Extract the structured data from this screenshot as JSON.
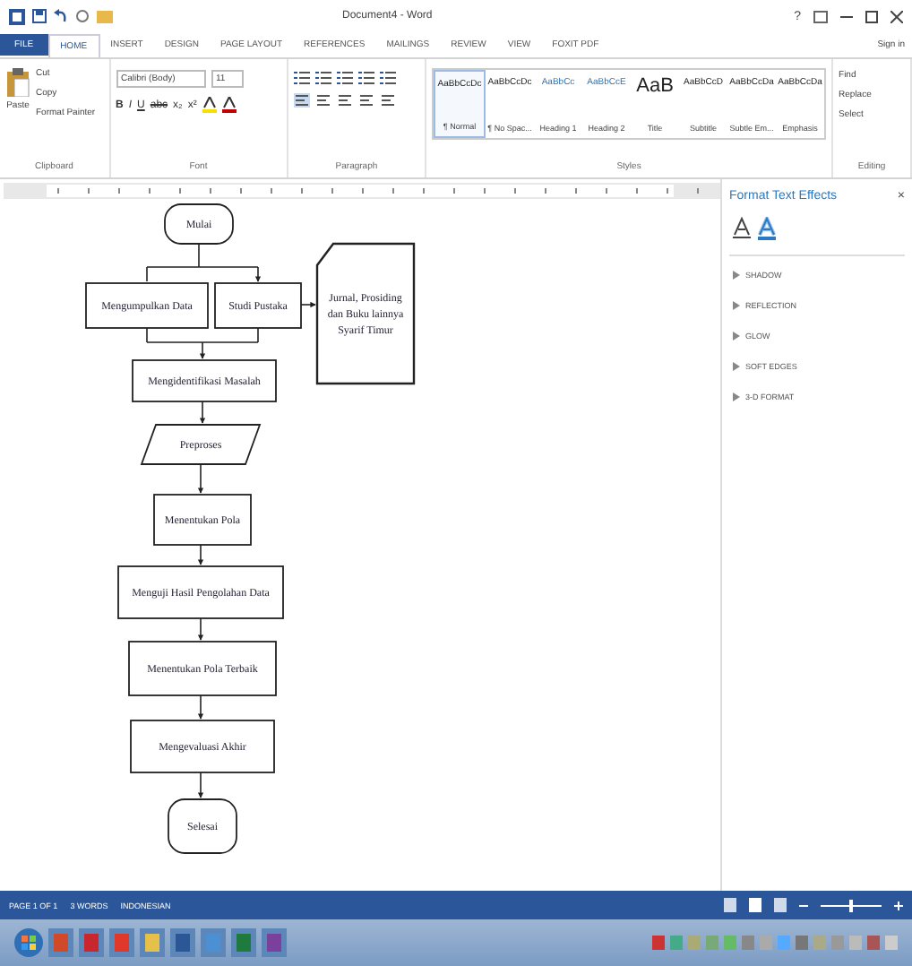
{
  "window": {
    "title": "Document4 - Word",
    "help": "?"
  },
  "tabs": [
    {
      "label": "FILE",
      "kind": "file",
      "selected": false
    },
    {
      "label": "HOME",
      "kind": "tab",
      "selected": true
    },
    {
      "label": "INSERT",
      "kind": "tab",
      "selected": false
    },
    {
      "label": "DESIGN",
      "kind": "tab",
      "selected": false
    },
    {
      "label": "PAGE LAYOUT",
      "kind": "tab",
      "selected": false
    },
    {
      "label": "REFERENCES",
      "kind": "tab",
      "selected": false
    },
    {
      "label": "MAILINGS",
      "kind": "tab",
      "selected": false
    },
    {
      "label": "REVIEW",
      "kind": "tab",
      "selected": false
    },
    {
      "label": "VIEW",
      "kind": "tab",
      "selected": false
    },
    {
      "label": "FOXIT PDF",
      "kind": "tab",
      "selected": false
    }
  ],
  "sign_in": "Sign in",
  "ribbon": {
    "clipboard": {
      "paste": "Paste",
      "items": [
        "Cut",
        "Copy",
        "Format Painter"
      ],
      "label": "Clipboard"
    },
    "font": {
      "family": "Calibri (Body)",
      "size": "11",
      "buttons": [
        "B",
        "I",
        "U",
        "abc",
        "x₂",
        "x²"
      ],
      "label": "Font"
    },
    "paragraph": {
      "label": "Paragraph"
    },
    "styles": {
      "items": [
        {
          "preview": "AaBbCcDc",
          "name": "¶ Normal",
          "kind": "body",
          "selected": true
        },
        {
          "preview": "AaBbCcDc",
          "name": "¶ No Spac...",
          "kind": "body",
          "selected": false
        },
        {
          "preview": "AaBbCc",
          "name": "Heading 1",
          "kind": "heading",
          "selected": false
        },
        {
          "preview": "AaBbCcE",
          "name": "Heading 2",
          "kind": "heading",
          "selected": false
        },
        {
          "preview": "AaB",
          "name": "Title",
          "kind": "title",
          "selected": false
        },
        {
          "preview": "AaBbCcD",
          "name": "Subtitle",
          "kind": "body",
          "selected": false
        },
        {
          "preview": "AaBbCcDa",
          "name": "Subtle Em...",
          "kind": "body",
          "selected": false
        },
        {
          "preview": "AaBbCcDa",
          "name": "Emphasis",
          "kind": "body",
          "selected": false
        }
      ],
      "label": "Styles"
    },
    "editing": {
      "items": [
        "Find",
        "Replace",
        "Select"
      ],
      "label": "Editing"
    }
  },
  "flowchart": {
    "nodes": [
      {
        "kind": "terminator",
        "label": "Mulai"
      },
      {
        "kind": "process",
        "label": "Mengumpulkan Data"
      },
      {
        "kind": "process",
        "label": "Studi Pustaka"
      },
      {
        "kind": "document",
        "lines": [
          "Jurnal, Prosiding",
          "dan Buku lainnya",
          "Syarif Timur"
        ]
      },
      {
        "kind": "process",
        "label": "Mengidentifikasi Masalah"
      },
      {
        "kind": "io",
        "label": "Preproses"
      },
      {
        "kind": "process",
        "label": "Menentukan Pola"
      },
      {
        "kind": "process",
        "label": "Menguji Hasil Pengolahan Data"
      },
      {
        "kind": "process",
        "label": "Menentukan Pola Terbaik"
      },
      {
        "kind": "process",
        "label": "Mengevaluasi Akhir"
      },
      {
        "kind": "terminator",
        "label": "Selesai"
      }
    ]
  },
  "pane": {
    "title": "Format Text Effects",
    "close": "×",
    "tabs": [
      {
        "kind": "fill",
        "selected": false
      },
      {
        "kind": "effects",
        "selected": true
      }
    ],
    "sections": [
      "SHADOW",
      "REFLECTION",
      "GLOW",
      "SOFT EDGES",
      "3-D FORMAT"
    ]
  },
  "status_bar": {
    "items": [
      "PAGE 1 OF 1",
      "3 WORDS",
      "INDONESIAN"
    ],
    "zoom": {
      "level": 0.5
    }
  }
}
